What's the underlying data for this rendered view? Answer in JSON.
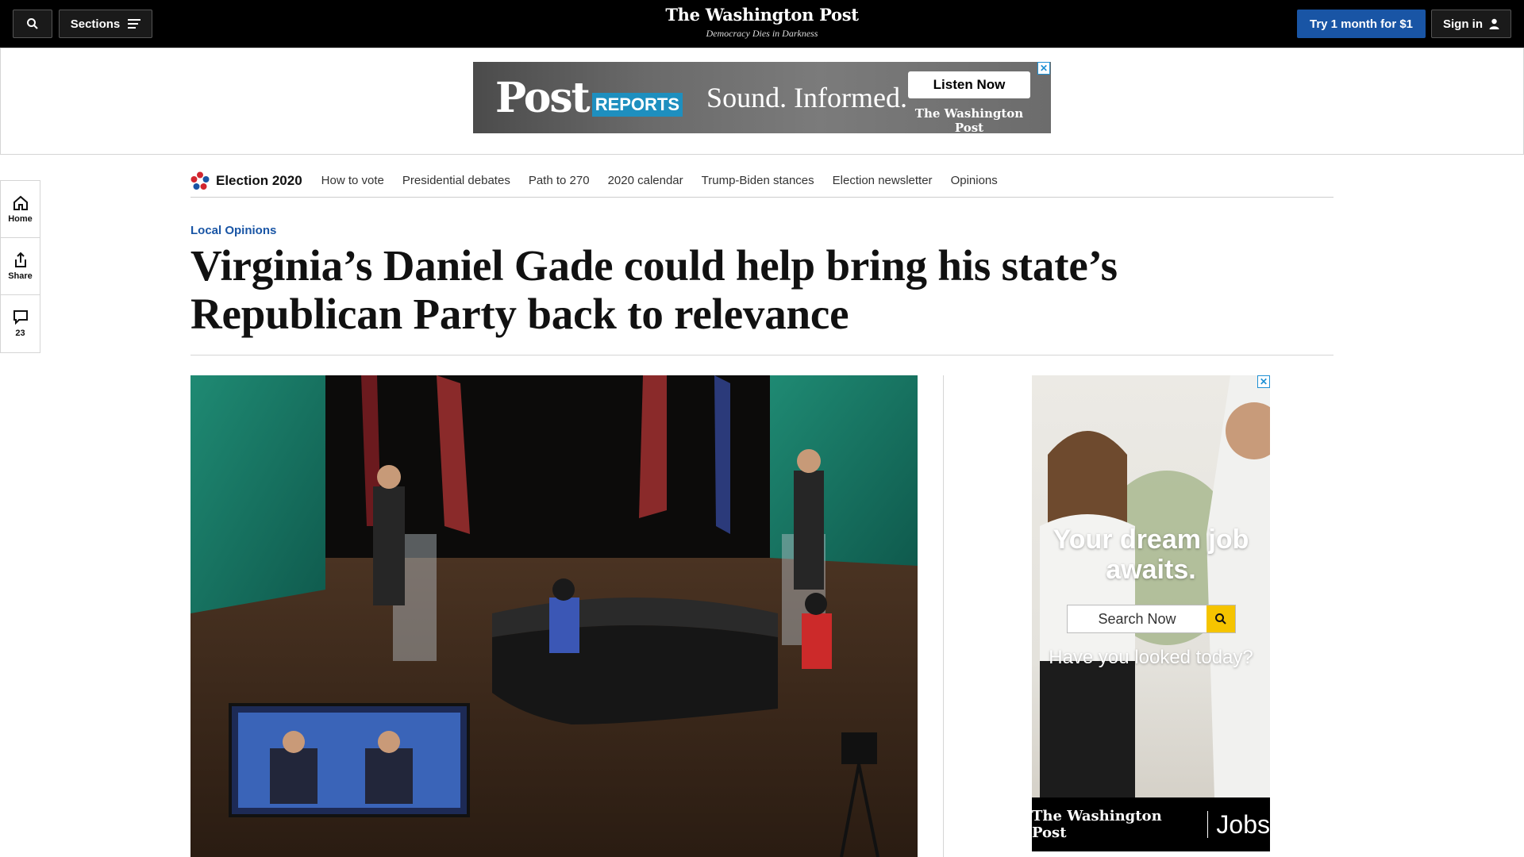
{
  "topbar": {
    "sections_label": "Sections",
    "logo": "The Washington Post",
    "tagline": "Democracy Dies in Darkness",
    "try_label": "Try 1 month for $1",
    "signin_label": "Sign in"
  },
  "top_ad": {
    "post": "Post",
    "reports": "REPORTS",
    "slogan": "Sound. Informed.",
    "cta": "Listen Now",
    "brand": "The Washington Post",
    "close": "✕"
  },
  "election_nav": {
    "title": "Election 2020",
    "links": [
      "How to vote",
      "Presidential debates",
      "Path to 270",
      "2020 calendar",
      "Trump-Biden stances",
      "Election newsletter",
      "Opinions"
    ]
  },
  "rail": {
    "home": "Home",
    "share": "Share",
    "comments": "23"
  },
  "article": {
    "kicker": "Local Opinions",
    "headline": "Virginia’s Daniel Gade could help bring his state’s Republican Party back to relevance"
  },
  "side_ad": {
    "headline": "Your dream job awaits.",
    "search_placeholder": "Search Now",
    "looked": "Have you looked today?",
    "brand": "The Washington Post",
    "jobs": "Jobs",
    "close": "✕"
  },
  "colors": {
    "accent": "#1955a5",
    "topbar": "#000000",
    "search_button": "#f5c400"
  }
}
